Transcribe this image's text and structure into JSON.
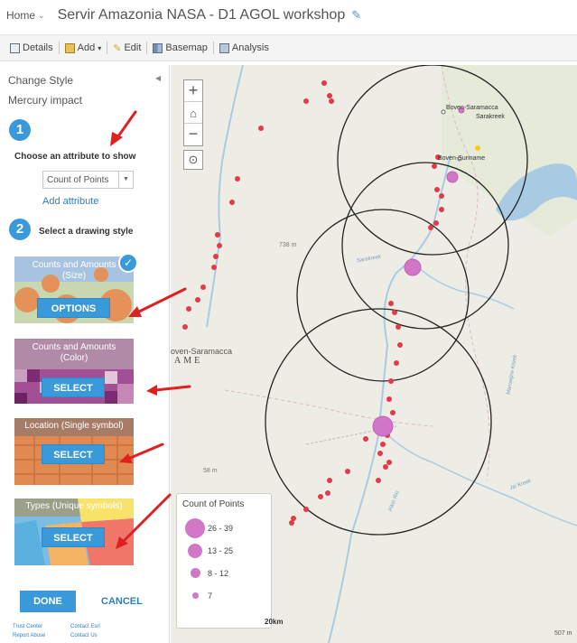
{
  "header": {
    "home_label": "Home",
    "map_title": "Servir Amazonia NASA - D1 AGOL workshop"
  },
  "toolbar": {
    "items": [
      {
        "label": "Details",
        "icon": "details-icon"
      },
      {
        "label": "Add",
        "icon": "add-icon"
      },
      {
        "label": "Edit",
        "icon": "edit-icon"
      },
      {
        "label": "Basemap",
        "icon": "basemap-icon"
      },
      {
        "label": "Analysis",
        "icon": "analysis-icon"
      }
    ]
  },
  "panel": {
    "title": "Change Style",
    "layer_name": "Mercury impact",
    "step1": {
      "number": "1",
      "label": "Choose an attribute to show"
    },
    "attribute": {
      "value": "Count of Points"
    },
    "add_attribute": "Add attribute",
    "step2": {
      "number": "2",
      "label": "Select a drawing style"
    },
    "styles": [
      {
        "title": "Counts and Amounts (Size)",
        "button": "OPTIONS",
        "selected": true
      },
      {
        "title": "Counts and Amounts (Color)",
        "button": "SELECT"
      },
      {
        "title": "Location (Single symbol)",
        "button": "SELECT"
      },
      {
        "title": "Types (Unique symbols)",
        "button": "SELECT"
      }
    ],
    "done": "DONE",
    "cancel": "CANCEL",
    "links": [
      "Trust Center",
      "Contact Esri",
      "Report Abuse",
      "Contact Us"
    ]
  },
  "map": {
    "place_labels": [
      "Boven-Saramacca",
      "Sarakreek",
      "Boven-Suriname",
      "oven-Saramacca",
      "AME",
      "738 m",
      "58 m",
      "Pikin Rio",
      "Jai Kreek",
      "Marowijne Kreek",
      "Sarakreek",
      "507 m"
    ],
    "scale_label": "20km",
    "legend": {
      "title": "Count of Points",
      "classes": [
        "26 - 39",
        "13 - 25",
        "8 - 12",
        "7"
      ]
    },
    "point_color": "#e03a4b",
    "symbol_color": "#d277c7"
  },
  "colors": {
    "accent": "#3a99d8",
    "arrow": "#e02020"
  }
}
